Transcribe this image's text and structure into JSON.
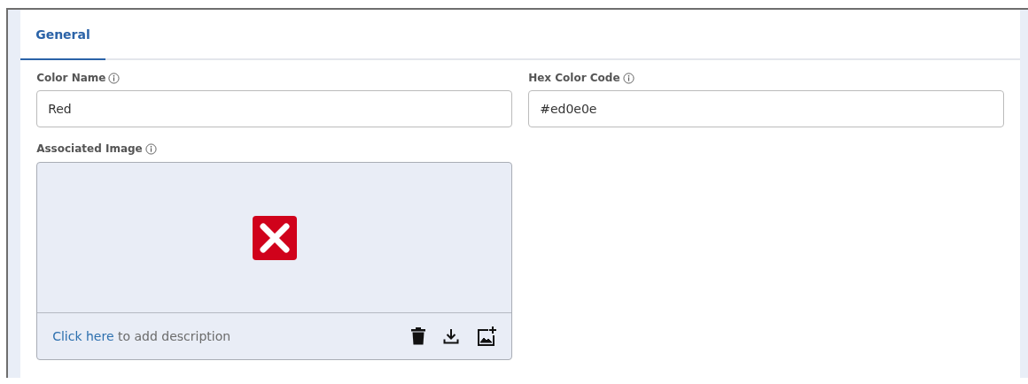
{
  "tabs": [
    {
      "label": "General",
      "selected": true
    }
  ],
  "fields": [
    {
      "label": "Color Name",
      "value": "Red"
    },
    {
      "label": "Hex Color Code",
      "value": "#ed0e0e"
    }
  ],
  "image_field": {
    "label": "Associated Image",
    "image_broken": true,
    "description_link": "Click here",
    "description_text": " to add description"
  }
}
